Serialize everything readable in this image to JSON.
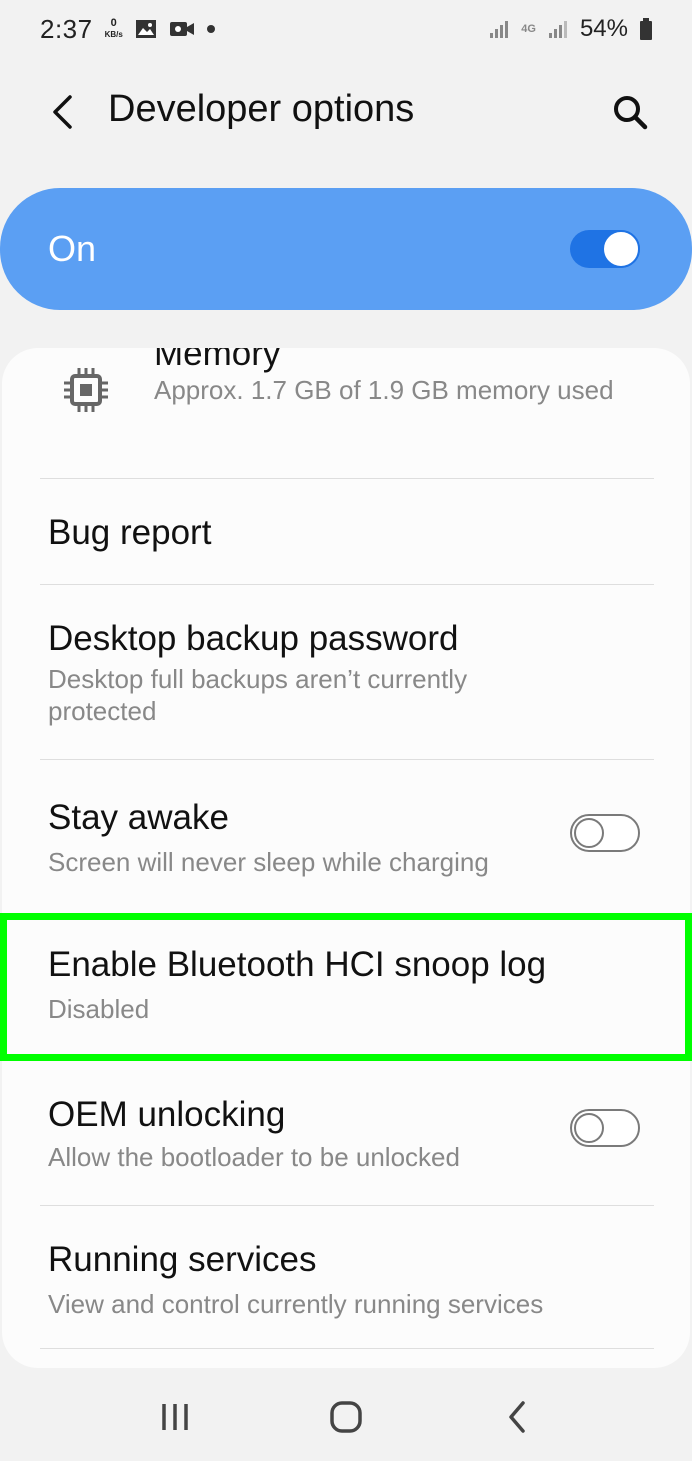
{
  "status_bar": {
    "time": "2:37",
    "data_speed_value": "0",
    "data_speed_unit": "KB/s",
    "network": "4G",
    "battery": "54%"
  },
  "app_bar": {
    "title": "Developer options"
  },
  "master_switch": {
    "label": "On",
    "state": "on",
    "accent": "#5b9ff3"
  },
  "settings": [
    {
      "title": "Memory",
      "subtitle": "Approx. 1.7 GB of 1.9 GB memory used",
      "icon": "chip-icon"
    },
    {
      "title": "Bug report"
    },
    {
      "title": "Desktop backup password",
      "subtitle": "Desktop full backups aren’t currently protected"
    },
    {
      "title": "Stay awake",
      "subtitle": "Screen will never sleep while charging",
      "toggle": "off"
    },
    {
      "title": "Enable Bluetooth HCI snoop log",
      "subtitle": "Disabled",
      "highlighted": true
    },
    {
      "title": "OEM unlocking",
      "subtitle": "Allow the bootloader to be unlocked",
      "toggle": "off"
    },
    {
      "title": "Running services",
      "subtitle": "View and control currently running services"
    }
  ],
  "highlight_color": "#00ff00",
  "nav_bar": {
    "buttons": [
      "recents-icon",
      "home-icon",
      "back-icon"
    ]
  }
}
